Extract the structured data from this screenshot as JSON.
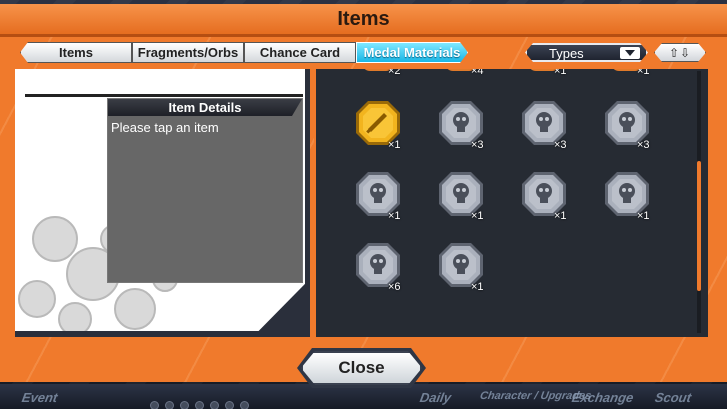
{
  "window": {
    "title": "Items"
  },
  "tabs": [
    {
      "label": "Items"
    },
    {
      "label": "Fragments/Orbs"
    },
    {
      "label": "Chance Card"
    },
    {
      "label": "Medal Materials",
      "active": true
    }
  ],
  "filter": {
    "selected": "Types",
    "sort_icon": "sort-up-down-icon"
  },
  "details": {
    "header": "Item Details",
    "hint": "Please tap an item"
  },
  "items_partial_top": [
    "×2",
    "×4",
    "×1",
    "×1"
  ],
  "items": [
    {
      "icon": "gold-sword-medal-icon",
      "count": "×1",
      "color": "#f2b41e"
    },
    {
      "icon": "silver-skull-medal-icon",
      "count": "×3",
      "color": "#aab0bc"
    },
    {
      "icon": "silver-skull-medal-icon",
      "count": "×3",
      "color": "#aab0bc"
    },
    {
      "icon": "silver-skull-medal-icon",
      "count": "×3",
      "color": "#aab0bc"
    },
    {
      "icon": "silver-skull-medal-icon",
      "count": "×1",
      "color": "#aab0bc"
    },
    {
      "icon": "silver-skull-medal-icon",
      "count": "×1",
      "color": "#aab0bc"
    },
    {
      "icon": "silver-skull-medal-icon",
      "count": "×1",
      "color": "#aab0bc"
    },
    {
      "icon": "silver-skull-medal-icon",
      "count": "×1",
      "color": "#aab0bc"
    },
    {
      "icon": "silver-skull-medal-icon",
      "count": "×6",
      "color": "#aab0bc"
    },
    {
      "icon": "silver-skull-medal-icon",
      "count": "×1",
      "color": "#aab0bc"
    }
  ],
  "footer": {
    "close_label": "Close"
  },
  "bottom_nav": [
    "Event",
    "Daily",
    "Character / Upgrades",
    "Exchange",
    "Scout"
  ],
  "colors": {
    "accent": "#f07a2c",
    "tab_active": "#19b6e6",
    "panel": "#262b33"
  }
}
